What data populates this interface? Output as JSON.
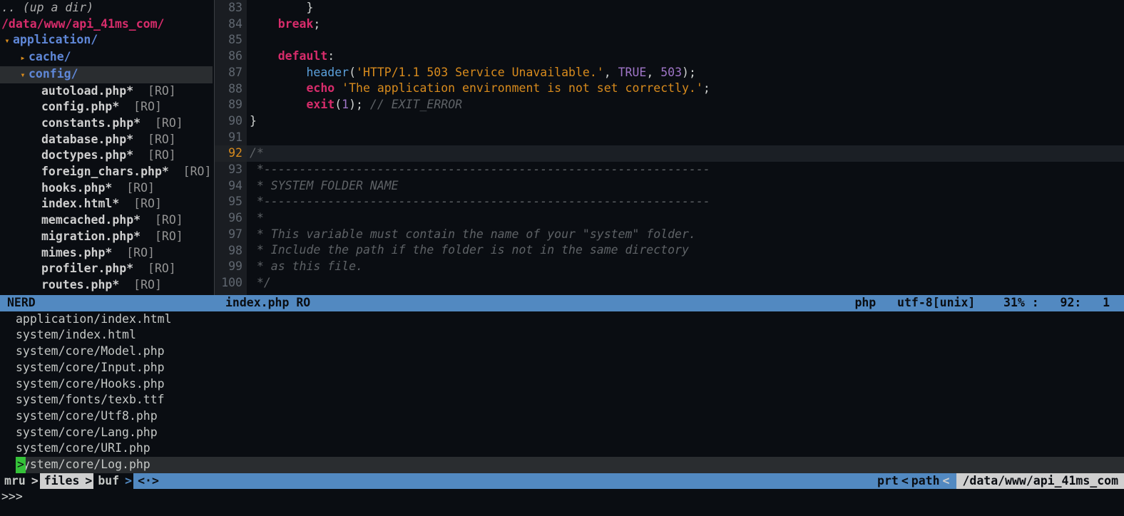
{
  "sidebar": {
    "updir": ".. (up a dir)",
    "path": "/data/www/api_41ms_com/",
    "dir0": "application/",
    "dir1a": "cache/",
    "dir1b": "config/",
    "files": [
      {
        "name": "autoload.php*",
        "ro": "[RO]"
      },
      {
        "name": "config.php*",
        "ro": "[RO]"
      },
      {
        "name": "constants.php*",
        "ro": "[RO]"
      },
      {
        "name": "database.php*",
        "ro": "[RO]"
      },
      {
        "name": "doctypes.php*",
        "ro": "[RO]"
      },
      {
        "name": "foreign_chars.php*",
        "ro": "[RO]"
      },
      {
        "name": "hooks.php*",
        "ro": "[RO]"
      },
      {
        "name": "index.html*",
        "ro": "[RO]"
      },
      {
        "name": "memcached.php*",
        "ro": "[RO]"
      },
      {
        "name": "migration.php*",
        "ro": "[RO]"
      },
      {
        "name": "mimes.php*",
        "ro": "[RO]"
      },
      {
        "name": "profiler.php*",
        "ro": "[RO]"
      },
      {
        "name": "routes.php*",
        "ro": "[RO]"
      }
    ]
  },
  "code": {
    "lines": [
      {
        "n": 83,
        "html_parts": [
          {
            "cls": "punc",
            "txt": "        }"
          }
        ]
      },
      {
        "n": 84,
        "html_parts": [
          {
            "cls": "punc",
            "txt": "    "
          },
          {
            "cls": "kw",
            "txt": "break"
          },
          {
            "cls": "punc",
            "txt": ";"
          }
        ]
      },
      {
        "n": 85,
        "html_parts": []
      },
      {
        "n": 86,
        "html_parts": [
          {
            "cls": "punc",
            "txt": "    "
          },
          {
            "cls": "kw",
            "txt": "default"
          },
          {
            "cls": "punc",
            "txt": ":"
          }
        ]
      },
      {
        "n": 87,
        "html_parts": [
          {
            "cls": "punc",
            "txt": "        "
          },
          {
            "cls": "fn",
            "txt": "header"
          },
          {
            "cls": "punc",
            "txt": "("
          },
          {
            "cls": "str",
            "txt": "'HTTP/1.1 503 Service Unavailable.'"
          },
          {
            "cls": "punc",
            "txt": ", "
          },
          {
            "cls": "const",
            "txt": "TRUE"
          },
          {
            "cls": "punc",
            "txt": ", "
          },
          {
            "cls": "num",
            "txt": "503"
          },
          {
            "cls": "punc",
            "txt": ");"
          }
        ]
      },
      {
        "n": 88,
        "html_parts": [
          {
            "cls": "punc",
            "txt": "        "
          },
          {
            "cls": "kw",
            "txt": "echo"
          },
          {
            "cls": "punc",
            "txt": " "
          },
          {
            "cls": "str",
            "txt": "'The application environment is not set correctly.'"
          },
          {
            "cls": "punc",
            "txt": ";"
          }
        ]
      },
      {
        "n": 89,
        "html_parts": [
          {
            "cls": "punc",
            "txt": "        "
          },
          {
            "cls": "kw",
            "txt": "exit"
          },
          {
            "cls": "punc",
            "txt": "("
          },
          {
            "cls": "num",
            "txt": "1"
          },
          {
            "cls": "punc",
            "txt": "); "
          },
          {
            "cls": "com",
            "txt": "// EXIT_ERROR"
          }
        ]
      },
      {
        "n": 90,
        "html_parts": [
          {
            "cls": "punc",
            "txt": "}"
          }
        ]
      },
      {
        "n": 91,
        "html_parts": []
      },
      {
        "n": 92,
        "cur": true,
        "html_parts": [
          {
            "cls": "com",
            "txt": "/*"
          }
        ]
      },
      {
        "n": 93,
        "html_parts": [
          {
            "cls": "com",
            "txt": " *---------------------------------------------------------------"
          }
        ]
      },
      {
        "n": 94,
        "html_parts": [
          {
            "cls": "com",
            "txt": " * SYSTEM FOLDER NAME"
          }
        ]
      },
      {
        "n": 95,
        "html_parts": [
          {
            "cls": "com",
            "txt": " *---------------------------------------------------------------"
          }
        ]
      },
      {
        "n": 96,
        "html_parts": [
          {
            "cls": "com",
            "txt": " *"
          }
        ]
      },
      {
        "n": 97,
        "html_parts": [
          {
            "cls": "com",
            "txt": " * This variable must contain the name of your \"system\" folder."
          }
        ]
      },
      {
        "n": 98,
        "html_parts": [
          {
            "cls": "com",
            "txt": " * Include the path if the folder is not in the same directory"
          }
        ]
      },
      {
        "n": 99,
        "html_parts": [
          {
            "cls": "com",
            "txt": " * as this file."
          }
        ]
      },
      {
        "n": 100,
        "html_parts": [
          {
            "cls": "com",
            "txt": " */"
          }
        ]
      }
    ]
  },
  "status": {
    "left": "NERD",
    "file": "index.php RO",
    "right": "php   utf-8[unix]    31% :   92:   1 "
  },
  "mru": [
    {
      "txt": "application/index.html"
    },
    {
      "txt": "system/index.html"
    },
    {
      "txt": "system/core/Model.php"
    },
    {
      "txt": "system/core/Input.php"
    },
    {
      "txt": "system/core/Hooks.php"
    },
    {
      "txt": "system/fonts/texb.ttf"
    },
    {
      "txt": "system/core/Utf8.php"
    },
    {
      "txt": "system/core/Lang.php"
    },
    {
      "txt": "system/core/URI.php"
    },
    {
      "txt": "system/core/Log.php",
      "sel": true
    }
  ],
  "bottombar": {
    "mru": "mru",
    "files": "files",
    "buf": "buf",
    "mid": "<·>",
    "prt": "prt",
    "path": "path",
    "fullpath": "/data/www/api_41ms_com"
  },
  "cmd": ">>> "
}
